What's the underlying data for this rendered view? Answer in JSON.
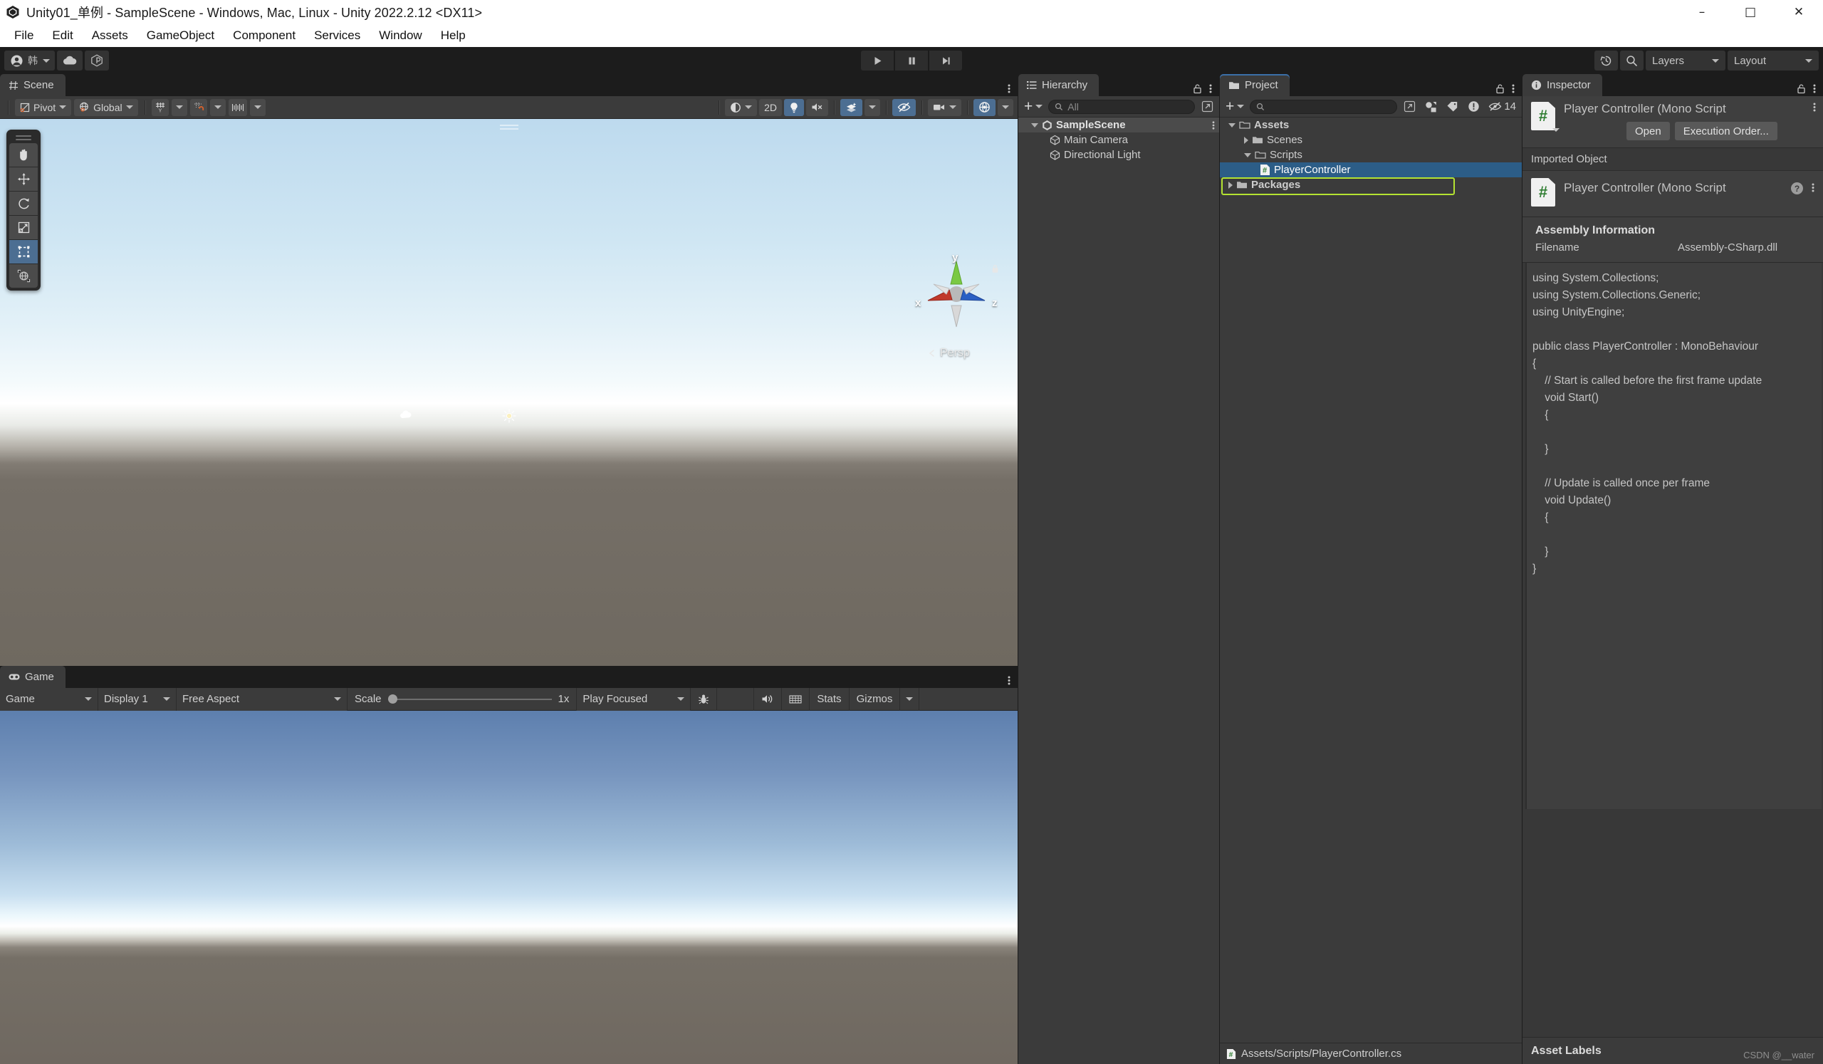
{
  "window": {
    "title": "Unity01_单例 - SampleScene - Windows, Mac, Linux - Unity 2022.2.12 <DX11>",
    "minimize": "–",
    "maximize": "□",
    "close": "✕"
  },
  "menu": {
    "items": [
      "File",
      "Edit",
      "Assets",
      "GameObject",
      "Component",
      "Services",
      "Window",
      "Help"
    ]
  },
  "toolbar": {
    "account_label": "韩",
    "cloud_icon": "cloud-icon",
    "services_icon": "unity-services-icon",
    "play_icon": "play-icon",
    "pause_icon": "pause-icon",
    "step_icon": "step-icon",
    "history_icon": "history-icon",
    "search_icon": "search-icon",
    "layers_label": "Layers",
    "layout_label": "Layout"
  },
  "scene": {
    "tab_label": "Scene",
    "tab_icon": "scene-grid-icon",
    "pivot_label": "Pivot",
    "global_label": "Global",
    "grid_icon": "grid-y-icon",
    "snap_icon": "snap-magnet-icon",
    "ruler_icon": "grid-snap-ruler-icon",
    "shading_icon": "shading-mode-icon",
    "twod_label": "2D",
    "lighting_icon": "lightbulb-icon",
    "audio_icon": "audio-mute-icon",
    "fx_icon": "effects-icon",
    "hidden_icon": "hidden-objects-icon",
    "camera_icon": "scene-camera-icon",
    "gizmos_icon": "gizmos-globe-icon",
    "persp_label": "Persp",
    "axis_x": "x",
    "axis_y": "y",
    "axis_z": "z",
    "gizmo_cloud": "cloud-gizmo",
    "gizmo_sun": "directional-light-gizmo",
    "tools": [
      {
        "name": "hand-tool",
        "icon": "hand-icon",
        "selected": false
      },
      {
        "name": "move-tool",
        "icon": "move-icon",
        "selected": false
      },
      {
        "name": "rotate-tool",
        "icon": "rotate-icon",
        "selected": false
      },
      {
        "name": "scale-tool",
        "icon": "scale-icon",
        "selected": false
      },
      {
        "name": "rect-tool",
        "icon": "rect-transform-icon",
        "selected": true
      },
      {
        "name": "transform-tool",
        "icon": "transform-icon",
        "selected": false
      }
    ]
  },
  "game": {
    "tab_label": "Game",
    "tab_icon": "game-controller-icon",
    "view_label": "Game",
    "display_label": "Display 1",
    "aspect_label": "Free Aspect",
    "scale_label": "Scale",
    "scale_value": "1x",
    "play_mode_label": "Play Focused",
    "debug_icon": "debug-bug-icon",
    "mute_icon": "mute-audio-icon",
    "grid_icon": "game-grid-icon",
    "stats_label": "Stats",
    "gizmos_label": "Gizmos"
  },
  "hierarchy": {
    "tab_label": "Hierarchy",
    "tab_icon": "hierarchy-icon",
    "add_label": "+",
    "search_placeholder": "All",
    "rows": [
      {
        "label": "SampleScene",
        "indent": 18,
        "icon": "unity-scene-icon",
        "expander": "down",
        "kind": "scene"
      },
      {
        "label": "Main Camera",
        "indent": 44,
        "icon": "gameobject-cube-icon",
        "expander": "none",
        "kind": "object"
      },
      {
        "label": "Directional Light",
        "indent": 44,
        "icon": "gameobject-cube-icon",
        "expander": "none",
        "kind": "object"
      }
    ]
  },
  "project": {
    "tab_label": "Project",
    "tab_icon": "folder-icon",
    "add_label": "+",
    "search_placeholder": "",
    "filter_icons": [
      "asset-filter-icon",
      "label-filter-icon",
      "warning-filter-icon"
    ],
    "hidden_count": "14",
    "rows": [
      {
        "label": "Assets",
        "indent": 12,
        "icon": "folder-open-icon",
        "expander": "down",
        "selected": false,
        "bold": true
      },
      {
        "label": "Scenes",
        "indent": 34,
        "icon": "folder-icon",
        "expander": "right",
        "selected": false,
        "bold": false
      },
      {
        "label": "Scripts",
        "indent": 34,
        "icon": "folder-open-icon",
        "expander": "down",
        "selected": false,
        "bold": false
      },
      {
        "label": "PlayerController",
        "indent": 56,
        "icon": "csharp-script-icon",
        "expander": "none",
        "selected": true,
        "bold": false
      },
      {
        "label": "Packages",
        "indent": 12,
        "icon": "folder-icon",
        "expander": "right",
        "selected": false,
        "bold": true
      }
    ],
    "status_path": "Assets/Scripts/PlayerController.cs",
    "status_icon": "csharp-script-icon"
  },
  "inspector": {
    "tab_label": "Inspector",
    "tab_icon": "info-icon",
    "script_title": "Player Controller (Mono Script",
    "open_label": "Open",
    "execution_order_label": "Execution Order...",
    "imported_object_label": "Imported Object",
    "imported_title": "Player Controller (Mono Script",
    "help_glyph": "?",
    "assembly_info_title": "Assembly Information",
    "filename_key": "Filename",
    "filename_value": "Assembly-CSharp.dll",
    "code": "using System.Collections;\nusing System.Collections.Generic;\nusing UnityEngine;\n\npublic class PlayerController : MonoBehaviour\n{\n    // Start is called before the first frame update\n    void Start()\n    {\n\n    }\n\n    // Update is called once per frame\n    void Update()\n    {\n\n    }\n}",
    "asset_labels_title": "Asset Labels",
    "watermark": "CSDN @__water"
  },
  "colors": {
    "accent_blue": "#2c5d87",
    "selection_outline": "#b4e332",
    "toolbar_active": "#4c6e92",
    "panel_bg": "#3b3b3b",
    "chrome_bg": "#1c1c1c"
  }
}
